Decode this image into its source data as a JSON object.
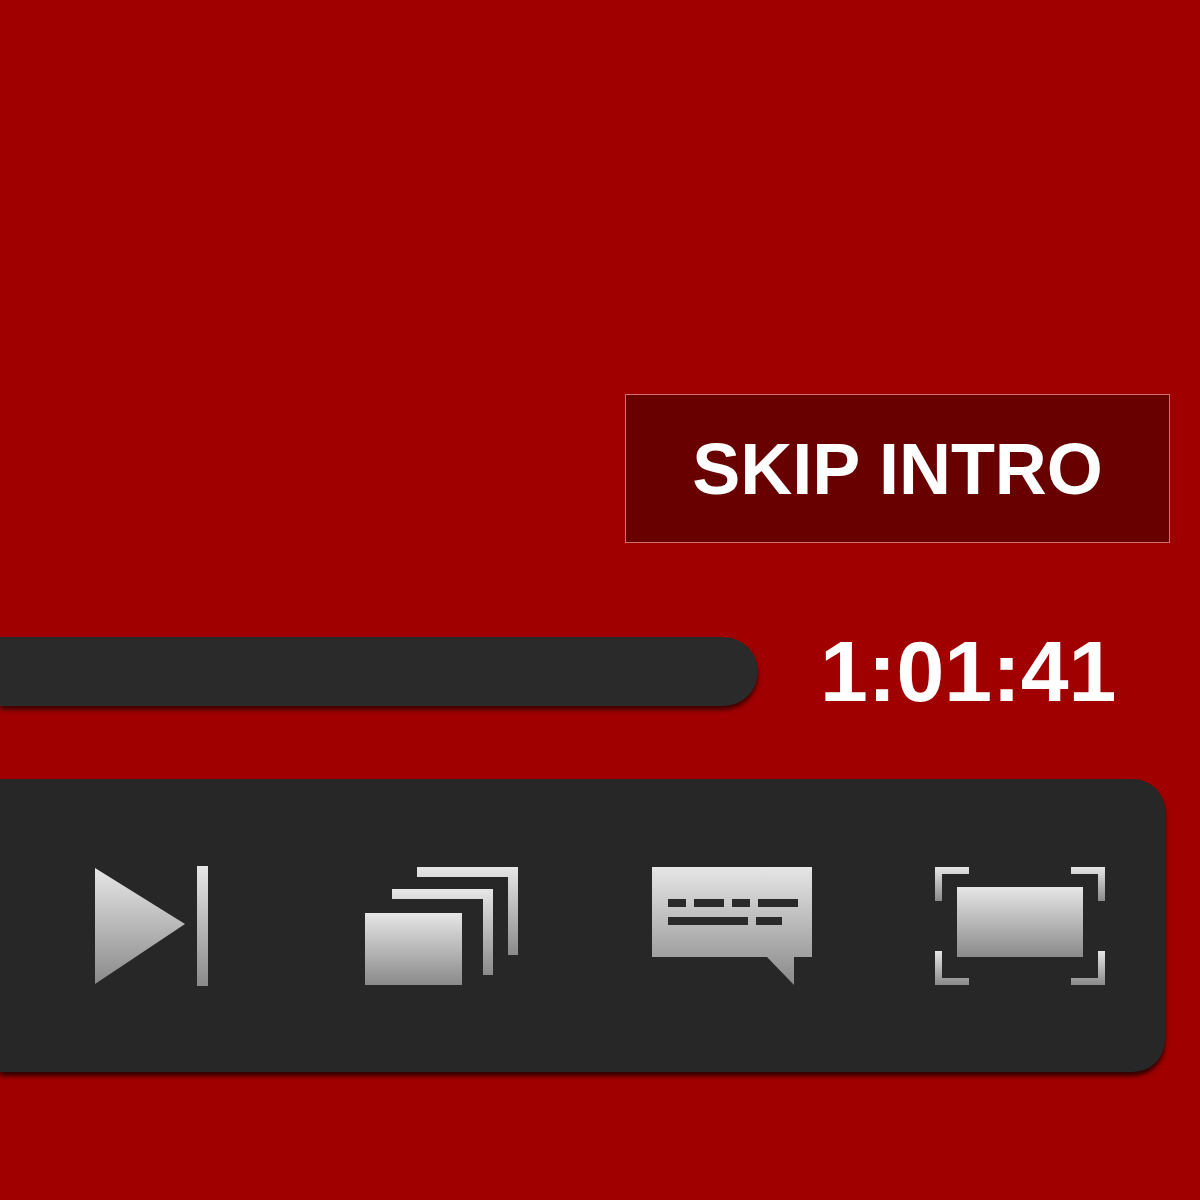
{
  "skip_button": {
    "label": "SKIP INTRO"
  },
  "progress": {
    "time": "1:01:41"
  },
  "controls": [
    {
      "kind": "next"
    },
    {
      "kind": "episodes"
    },
    {
      "kind": "subtitles"
    },
    {
      "kind": "fullscreen"
    }
  ]
}
